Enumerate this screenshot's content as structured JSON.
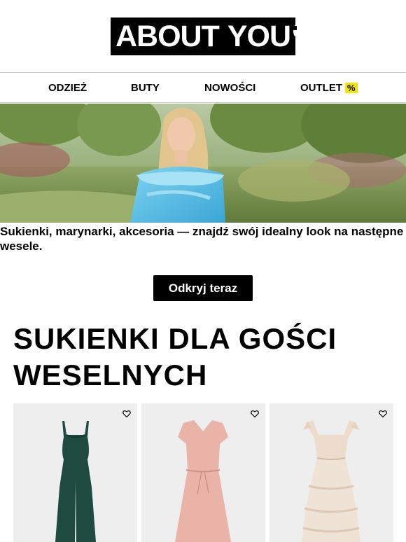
{
  "brand": {
    "logo_left": "ABOUT",
    "logo_right": "YOU"
  },
  "nav": {
    "items": [
      {
        "label": "ODZIEŻ"
      },
      {
        "label": "BUTY"
      },
      {
        "label": "NOWOŚCI"
      },
      {
        "label": "OUTLET",
        "badge": "%"
      }
    ]
  },
  "hero": {
    "text": "Sukienki, marynarki, akcesoria — znajdź swój idealny look na następne wesele.",
    "cta_label": "Odkryj teraz"
  },
  "section": {
    "title": "SUKIENKI DLA GOŚCI WESELNYCH"
  },
  "products": [
    {
      "icon": "heart-icon",
      "color": "#1f4a40"
    },
    {
      "icon": "heart-icon",
      "color": "#e9b3a8"
    },
    {
      "icon": "heart-icon",
      "color": "#eddccb"
    }
  ],
  "colors": {
    "accent_badge": "#f5e400",
    "primary": "#000000"
  }
}
